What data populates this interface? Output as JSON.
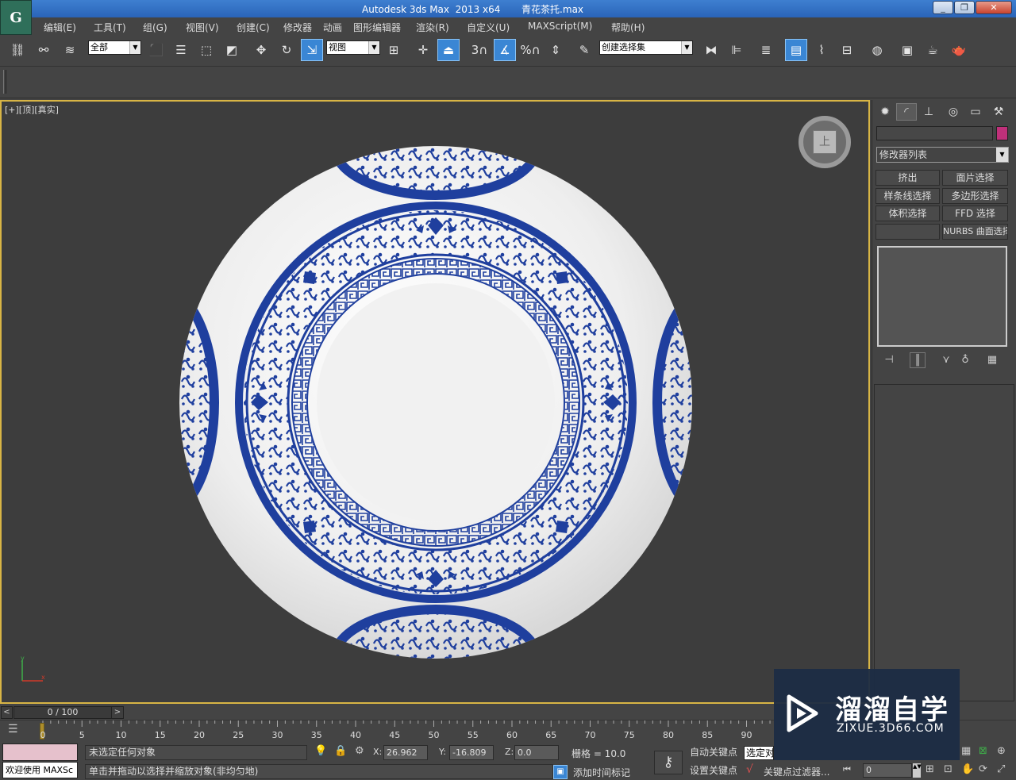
{
  "window": {
    "title": "Autodesk 3ds Max  2013 x64       青花茶托.max",
    "logo": "G",
    "minimize_label": "_",
    "restore_label": "❐",
    "close_label": "✕"
  },
  "menu": [
    "编辑(E)",
    "工具(T)",
    "组(G)",
    "视图(V)",
    "创建(C)",
    "修改器",
    "动画",
    "图形编辑器",
    "渲染(R)",
    "自定义(U)",
    "MAXScript(M)",
    "帮助(H)"
  ],
  "toolbar": {
    "selection_filter": "全部",
    "reference_coord": "视图",
    "named_selection_set": "创建选择集",
    "snap_label": "3",
    "angle_snap_label": "%"
  },
  "viewport": {
    "label": "[+][顶][真实]",
    "viewcube_face": "上",
    "border_color": "#d8b545",
    "plate": {
      "pattern_color": "#1f3f9e",
      "porcelain_color": "#f2f2f2"
    }
  },
  "command_panel": {
    "object_color": "#c0307a",
    "modifier_list": "修改器列表",
    "modifier_buttons": [
      "挤出",
      "面片选择",
      "样条线选择",
      "多边形选择",
      "体积选择",
      "FFD 选择",
      "",
      "NURBS 曲面选择"
    ]
  },
  "timeline": {
    "frame_display": "0 / 100",
    "prev_label": "<",
    "next_label": ">",
    "ticks": [
      "0",
      "5",
      "10",
      "15",
      "20",
      "25",
      "30",
      "35",
      "40",
      "45",
      "50",
      "55",
      "60",
      "65",
      "70",
      "75",
      "80",
      "85",
      "90"
    ]
  },
  "status": {
    "welcome": "欢迎使用 MAXSc",
    "selection": "未选定任何对象",
    "prompt": "单击并拖动以选择并缩放对象(非均匀地)",
    "x_label": "X:",
    "x_value": "26.962",
    "y_label": "Y:",
    "y_value": "-16.809",
    "z_label": "Z:",
    "z_value": "0.0",
    "grid": "栅格 = 10.0",
    "add_time_tag": "添加时间标记",
    "auto_key": "自动关键点",
    "set_key": "设置关键点",
    "selected_object": "选定对",
    "key_filters": "关键点过滤器...",
    "current_frame": "0"
  },
  "watermark": {
    "title": "溜溜自学",
    "url": "ZIXUE.3D66.COM"
  }
}
